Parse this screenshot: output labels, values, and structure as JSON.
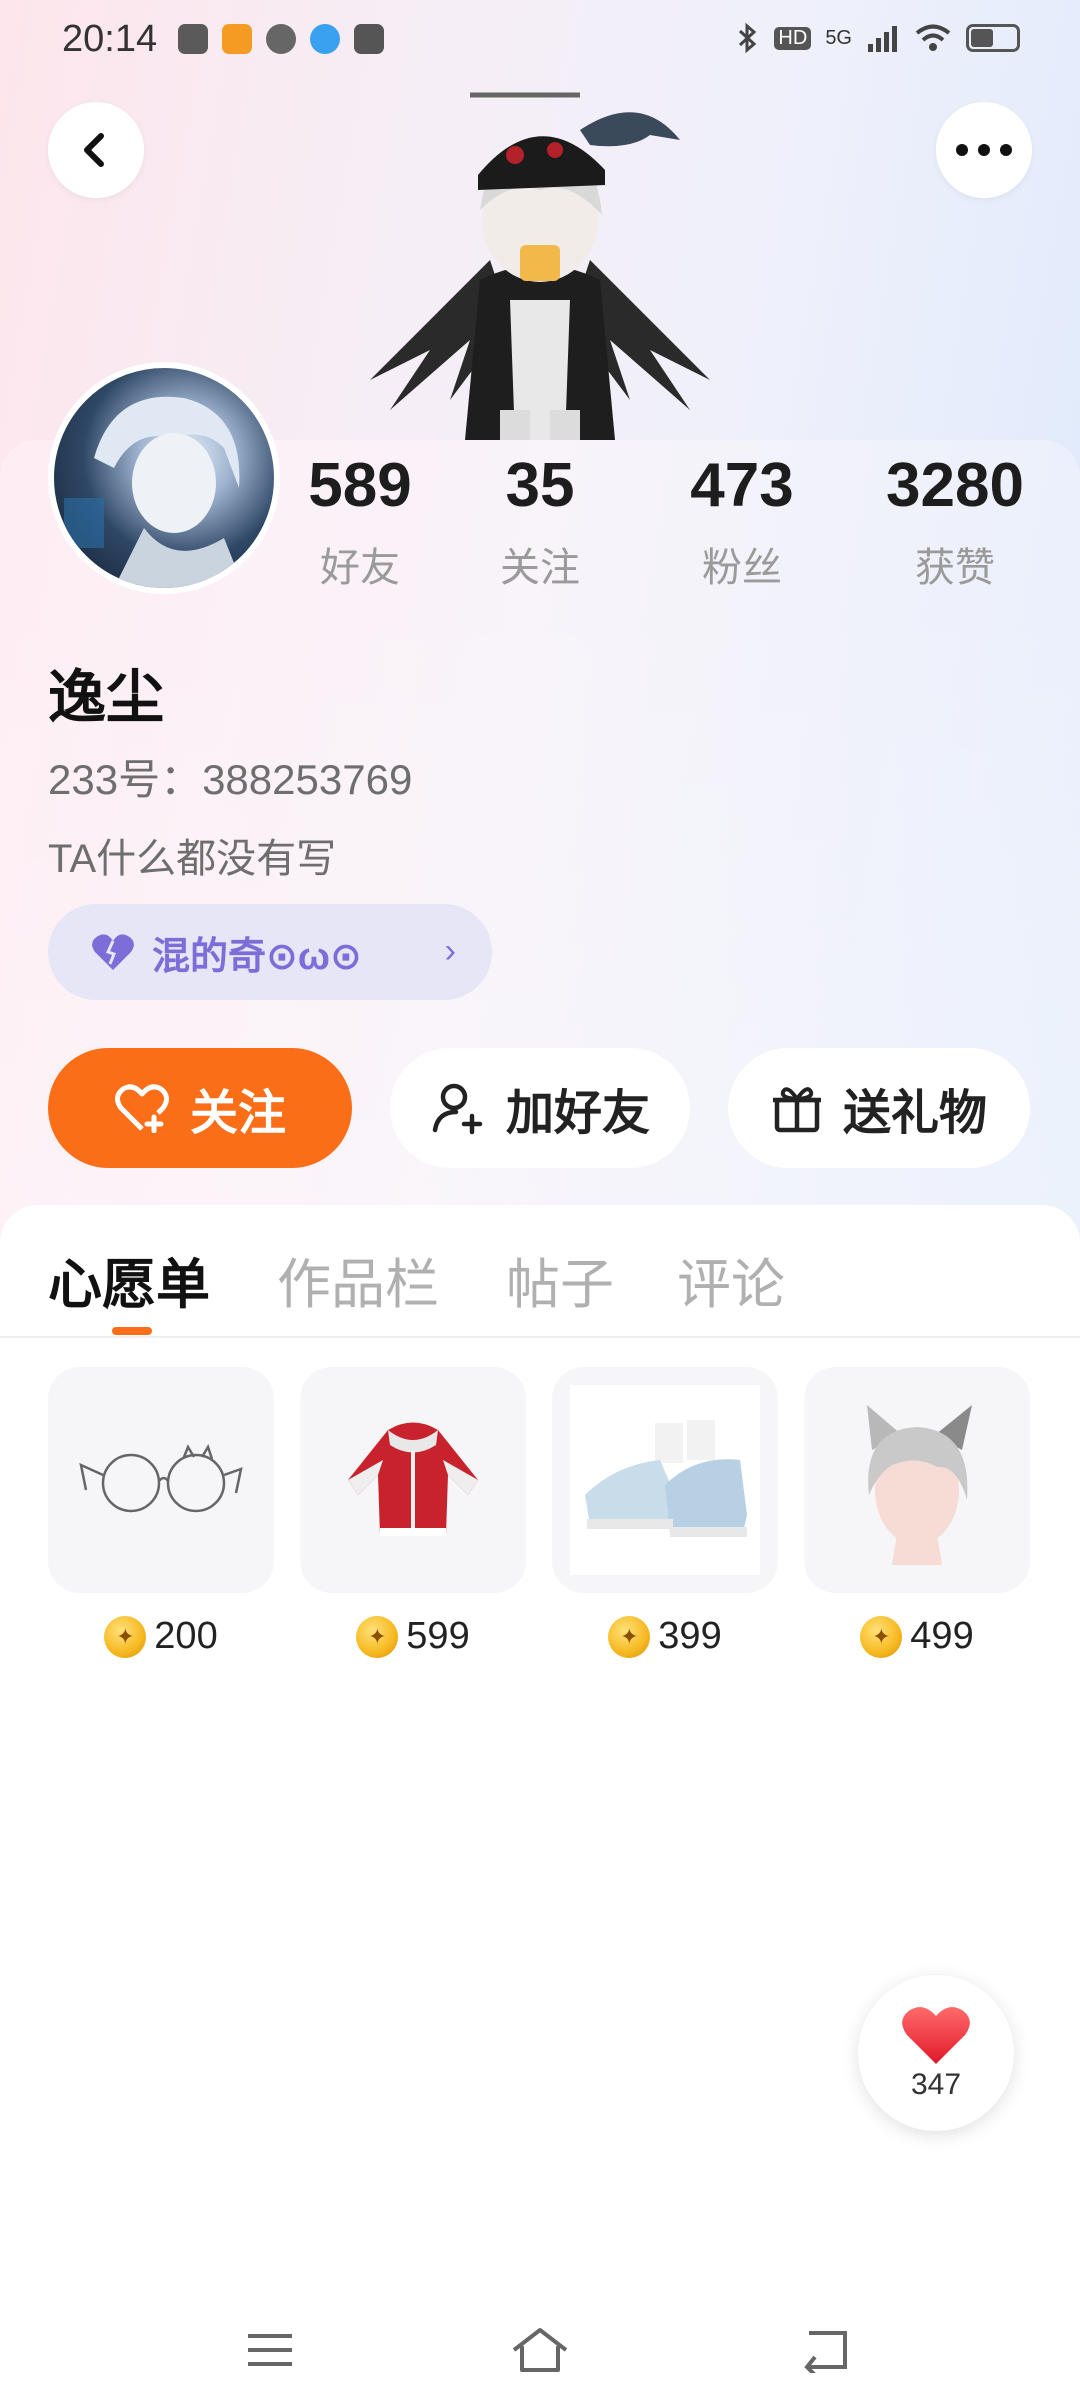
{
  "status_bar": {
    "time": "20:14",
    "network": "5G",
    "hd": "HD"
  },
  "header": {
    "back_icon": "chevron-left-icon",
    "more_icon": "more-dots-icon"
  },
  "profile": {
    "stats": [
      {
        "value": "589",
        "label": "好友"
      },
      {
        "value": "35",
        "label": "关注"
      },
      {
        "value": "473",
        "label": "粉丝"
      },
      {
        "value": "3280",
        "label": "获赞"
      }
    ],
    "name": "逸尘",
    "id_text": "233号：388253769",
    "bio": "TA什么都没有写",
    "tag": "混的奇⊙ω⊙"
  },
  "actions": {
    "follow_label": "关注",
    "add_friend_label": "加好友",
    "gift_label": "送礼物"
  },
  "tabs": [
    {
      "label": "心愿单",
      "active": true
    },
    {
      "label": "作品栏",
      "active": false
    },
    {
      "label": "帖子",
      "active": false
    },
    {
      "label": "评论",
      "active": false
    }
  ],
  "wishlist": [
    {
      "item": "glasses",
      "price": "200"
    },
    {
      "item": "red-jacket",
      "price": "599"
    },
    {
      "item": "sneakers",
      "price": "399"
    },
    {
      "item": "cat-ear-hair",
      "price": "499"
    }
  ],
  "like_button": {
    "count": "347"
  },
  "colors": {
    "accent": "#fb6e18",
    "tag_text": "#7c6dd8",
    "tag_bg": "#e7e6f6",
    "like_red": "#f3333f"
  }
}
